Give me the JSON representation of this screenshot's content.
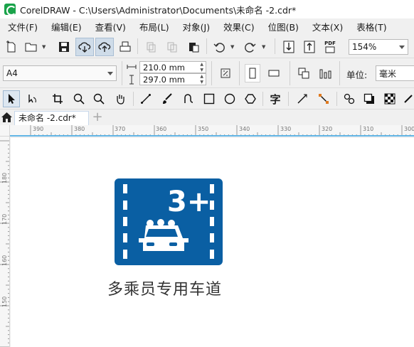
{
  "window": {
    "title": "CorelDRAW - C:\\Users\\Administrator\\Documents\\未命名 -2.cdr*"
  },
  "menu": [
    "文件(F)",
    "编辑(E)",
    "查看(V)",
    "布局(L)",
    "对象(J)",
    "效果(C)",
    "位图(B)",
    "文本(X)",
    "表格(T)"
  ],
  "toolbar": {
    "pdf_label": "PDF",
    "zoom": "154%"
  },
  "property_bar": {
    "page_size": "A4",
    "width": "210.0 mm",
    "height": "297.0 mm",
    "units_label": "单位:",
    "units_value": "毫米"
  },
  "toolbox": {
    "text_tool": "字"
  },
  "document_tabs": [
    {
      "label": "未命名 -2.cdr*"
    }
  ],
  "add_tab": "+",
  "ruler": {
    "horizontal": [
      "390",
      "380",
      "370",
      "360",
      "350",
      "340",
      "330",
      "320",
      "310",
      "300"
    ],
    "vertical": [
      "180",
      "170",
      "160",
      "150"
    ]
  },
  "sign": {
    "number": "3+",
    "caption": "多乘员专用车道",
    "color": "#0a5fa3"
  }
}
